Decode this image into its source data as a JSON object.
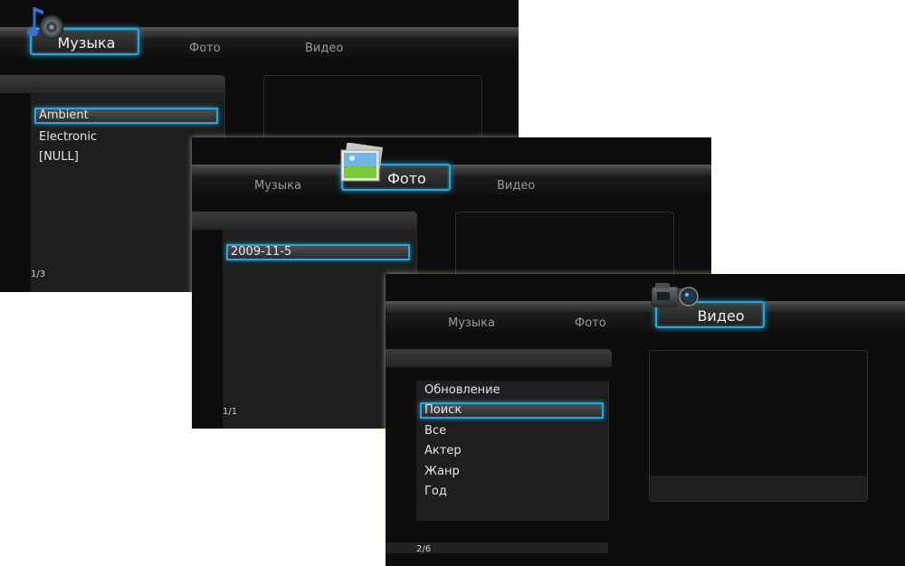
{
  "screens": {
    "music": {
      "tabs": {
        "music": "Музыка",
        "photo": "Фото",
        "video": "Видео"
      },
      "active_tab": "music",
      "icon": "music-speaker-icon",
      "items": [
        "Ambient",
        "Electronic",
        "[NULL]"
      ],
      "selected_index": 0,
      "counter": "1/3"
    },
    "photo": {
      "tabs": {
        "music": "Музыка",
        "photo": "Фото",
        "video": "Видео"
      },
      "active_tab": "photo",
      "icon": "photo-landscape-icon",
      "items": [
        "2009-11-5"
      ],
      "selected_index": 0,
      "counter": "1/1"
    },
    "video": {
      "tabs": {
        "music": "Музыка",
        "photo": "Фото",
        "video": "Видео"
      },
      "active_tab": "video",
      "icon": "video-camcorder-icon",
      "items": [
        "Обновление",
        "Поиск",
        "Все",
        "Актер",
        "Жанр",
        "Год"
      ],
      "selected_index": 1,
      "counter": "2/6"
    }
  },
  "colors": {
    "accent": "#29a8d8",
    "screen_bg": "#0d0d0d",
    "panel": "#1e1e1e"
  }
}
